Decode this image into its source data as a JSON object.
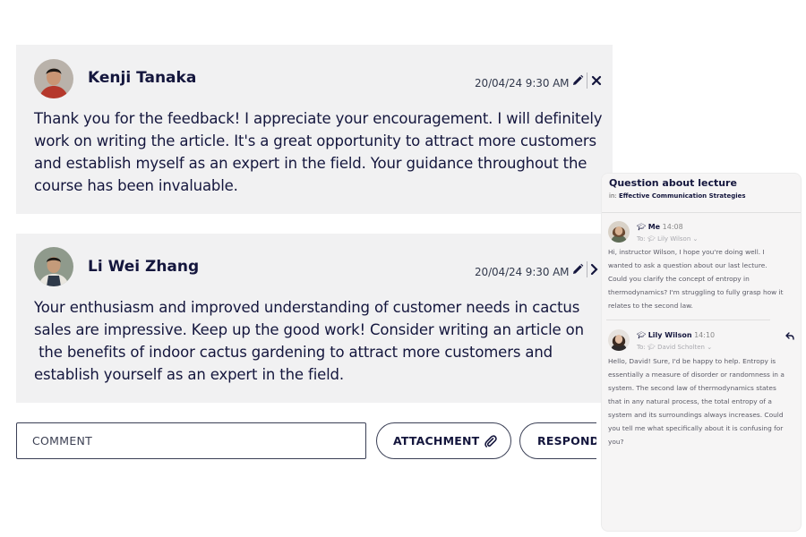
{
  "comments": [
    {
      "author": "Kenji Tanaka",
      "timestamp": "20/04/24 9:30 AM",
      "avatar_icon": "avatar-photo-icon",
      "text": "Thank you for the feedback! I appreciate your encouragement. I will definitely\nwork on writing the article. It's a great opportunity to attract more customers\nand establish myself as an expert in the field. Your guidance throughout the\ncourse has been invaluable."
    },
    {
      "author": "Li Wei Zhang",
      "timestamp": "20/04/24 9:30 AM",
      "avatar_icon": "avatar-photo-icon",
      "text": "Your enthusiasm and improved understanding of customer needs in cactus\nsales are impressive. Keep up the good work! Consider writing an article on\n the benefits of indoor cactus gardening to attract more customers and\nestablish yourself as an expert in the field."
    }
  ],
  "composer": {
    "placeholder": "COMMENT",
    "attachment_label": "ATTACHMENT",
    "respond_label": "RESPOND"
  },
  "panel": {
    "title": "Question about lecture",
    "in_prefix": "in:",
    "course": "Effective Communication Strategies",
    "messages": [
      {
        "sender": "Me",
        "time": "14:08",
        "to_prefix": "To:",
        "to": "Lily Wilson",
        "text": "Hi, instructor Wilson, I hope you're doing well. I\nwanted to ask a question about our last lecture.\nCould you clarify the concept of entropy in\nthermodynamics? I'm struggling to fully grasp how it\nrelates to the second law."
      },
      {
        "sender": "Lily Wilson",
        "time": "14:10",
        "to_prefix": "To:",
        "to": "David Scholten",
        "text": "Hello, David! Sure, I'd be happy to help. Entropy is\nessentially a measure of disorder or randomness in a\nsystem. The second law of thermodynamics states\nthat in any natural process, the total entropy of a\nsystem and its surroundings always increases. Could\nyou tell me what specifically about it is confusing for\nyou?"
      }
    ]
  },
  "colors": {
    "card_bg": "#f1f1f2",
    "text_dark": "#14163d",
    "border": "#3a3f55",
    "panel_bg": "#f6f5f5"
  }
}
